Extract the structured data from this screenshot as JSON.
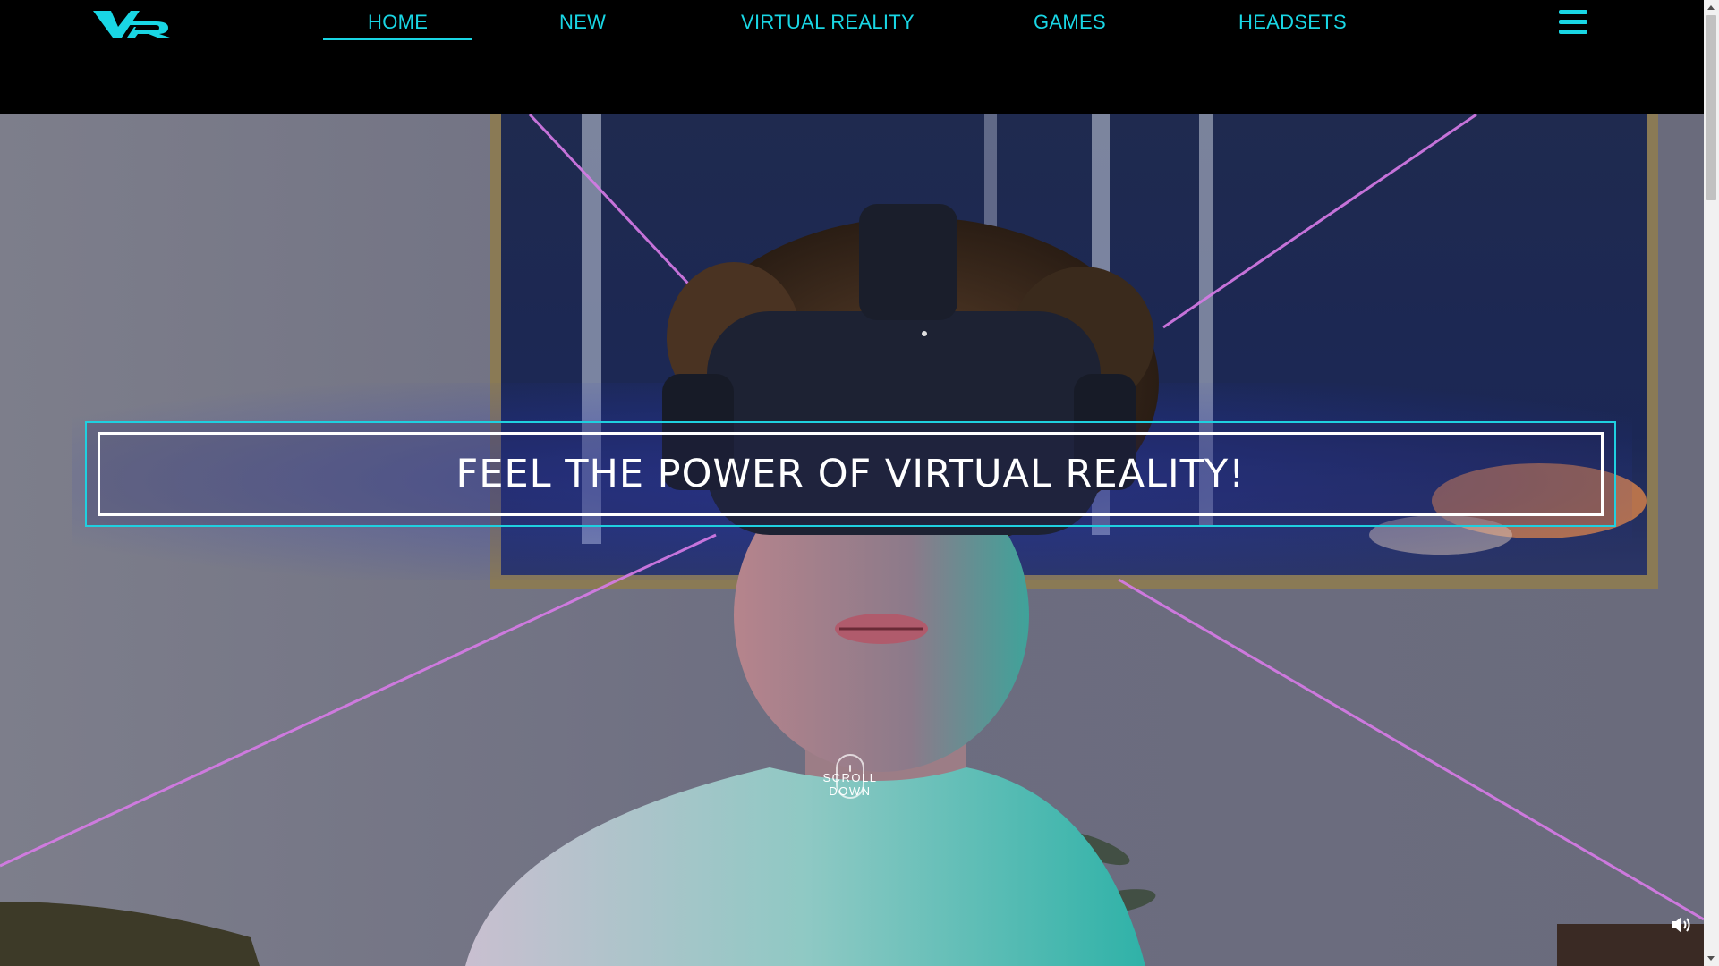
{
  "header": {
    "logo_text": "VR",
    "nav": [
      {
        "label": "HOME",
        "active": true
      },
      {
        "label": "NEW",
        "active": false
      },
      {
        "label": "VIRTUAL REALITY",
        "active": false
      },
      {
        "label": "GAMES",
        "active": false
      },
      {
        "label": "HEADSETS",
        "active": false
      }
    ],
    "menu_icon": "hamburger-menu-icon"
  },
  "hero": {
    "headline": "FEEL THE POWER OF VIRTUAL REALITY!",
    "scroll_label": "SCROLL DOWN",
    "scroll_icon": "mouse-icon",
    "sound_icon": "speaker-volume-icon"
  },
  "colors": {
    "accent": "#19d6e4",
    "header_bg": "#000000",
    "laser": "#d87be8",
    "banner_border": "#1fd0e0",
    "banner_inner_border": "#ffffff"
  }
}
